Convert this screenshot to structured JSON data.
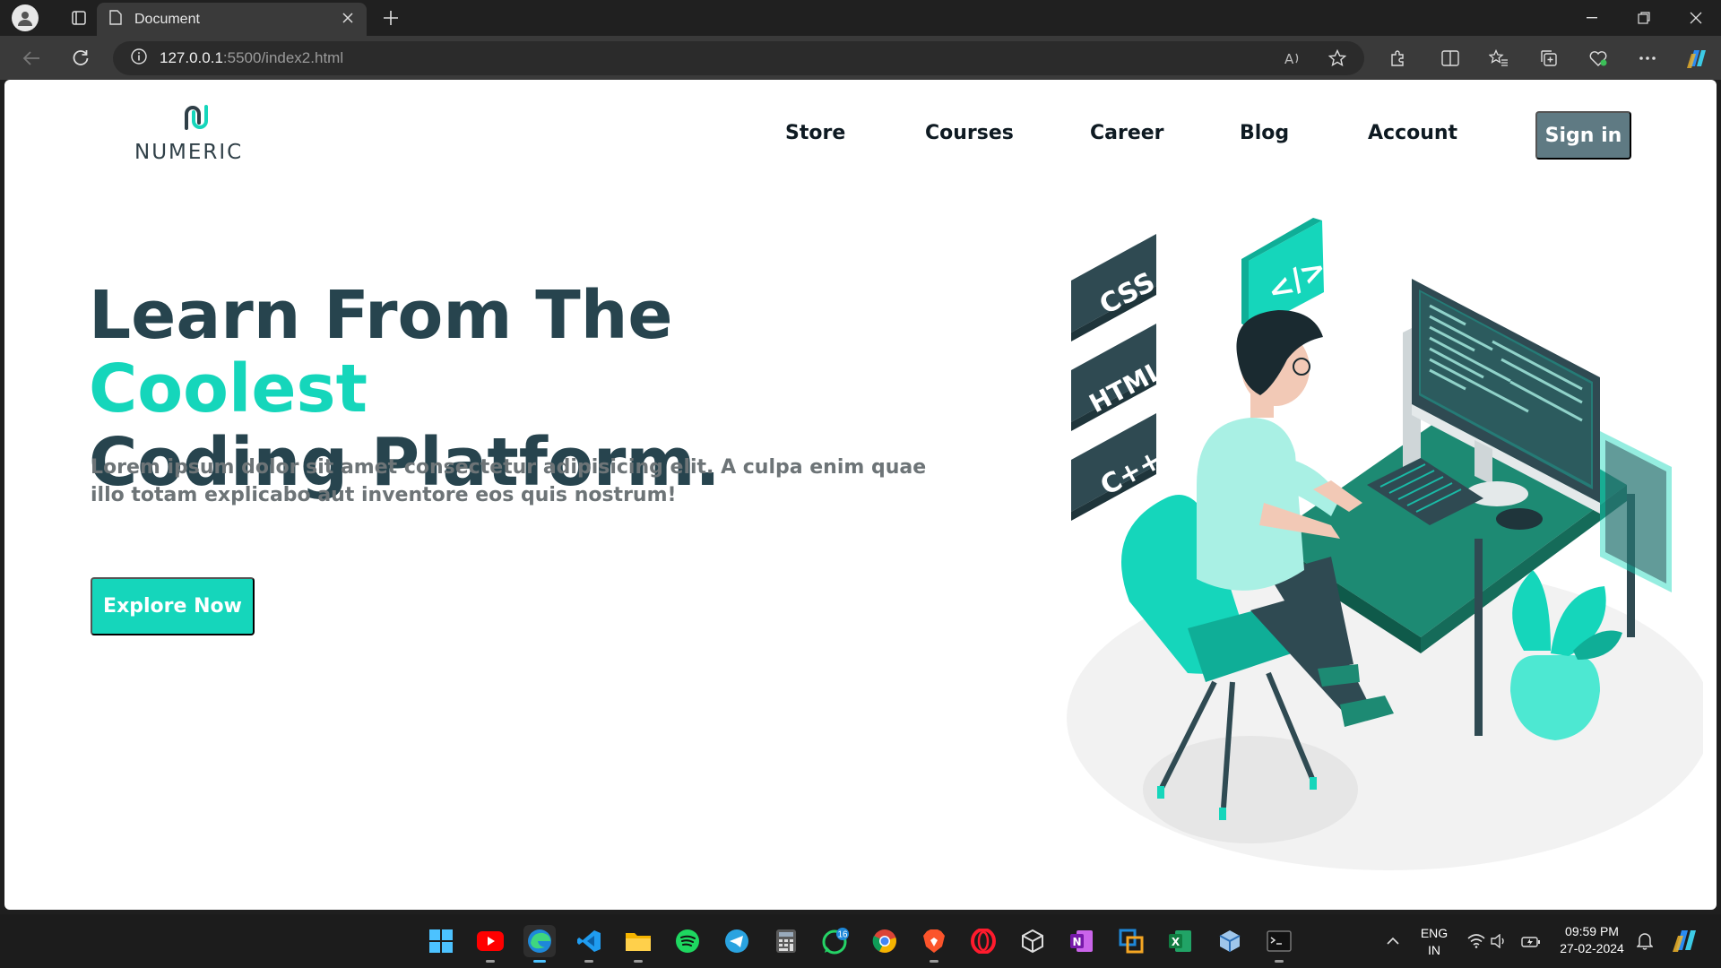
{
  "browser": {
    "tab_title": "Document",
    "url_host": "127.0.0.1",
    "url_path": ":5500/index2.html"
  },
  "site": {
    "logo_text": "NUMERIC",
    "nav": [
      "Store",
      "Courses",
      "Career",
      "Blog",
      "Account"
    ],
    "signin_label": "Sign in",
    "hero": {
      "title_line1_plain": "Learn From The ",
      "title_line1_accent": "Coolest",
      "title_line2": "Coding Platform.",
      "text": "Lorem ipsum dolor sit amet consectetur adipisicing elit. A culpa enim quae illo totam explicabo aut inventore eos quis nostrum!",
      "button_label": "Explore Now"
    },
    "illustration_badges": [
      "CSS",
      "HTML",
      "C++"
    ],
    "colors": {
      "accent": "#15d6bb",
      "dark": "#27444e",
      "button_gray": "#5f7a83"
    }
  },
  "taskbar": {
    "whatsapp_badge": "16",
    "lang_line1": "ENG",
    "lang_line2": "IN",
    "time": "09:59 PM",
    "date": "27-02-2024"
  }
}
